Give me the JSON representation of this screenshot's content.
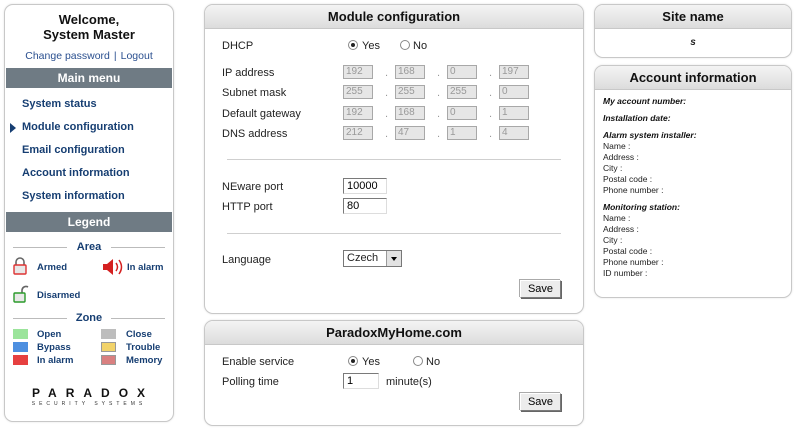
{
  "left": {
    "welcome_line1": "Welcome,",
    "welcome_line2": "System Master",
    "change_password": "Change password",
    "separator": "|",
    "logout": "Logout",
    "main_menu_title": "Main menu",
    "menu": [
      {
        "label": "System status",
        "active": false
      },
      {
        "label": "Module configuration",
        "active": true
      },
      {
        "label": "Email configuration",
        "active": false
      },
      {
        "label": "Account information",
        "active": false
      },
      {
        "label": "System information",
        "active": false
      }
    ],
    "legend_title": "Legend",
    "area_title": "Area",
    "area_items": {
      "armed": "Armed",
      "in_alarm": "In alarm",
      "disarmed": "Disarmed"
    },
    "zone_title": "Zone",
    "zone_items": [
      {
        "label": "Open",
        "color": "#9be49b"
      },
      {
        "label": "Close",
        "color": "#bdbdbd"
      },
      {
        "label": "Bypass",
        "color": "#4d8fe0"
      },
      {
        "label": "Trouble",
        "color": "#f2d36a"
      },
      {
        "label": "In alarm",
        "color": "#e64040"
      },
      {
        "label": "Memory",
        "color": "#d98080"
      }
    ],
    "logo_text": "PARADOX",
    "logo_sub": "SECURITY SYSTEMS"
  },
  "module": {
    "title": "Module configuration",
    "dhcp_label": "DHCP",
    "dhcp_yes": "Yes",
    "dhcp_no": "No",
    "dhcp_selected": "Yes",
    "ip_label": "IP address",
    "ip": [
      "192",
      "168",
      "0",
      "197"
    ],
    "mask_label": "Subnet mask",
    "mask": [
      "255",
      "255",
      "255",
      "0"
    ],
    "gw_label": "Default gateway",
    "gw": [
      "192",
      "168",
      "0",
      "1"
    ],
    "dns_label": "DNS address",
    "dns": [
      "212",
      "47",
      "1",
      "4"
    ],
    "dot": ".",
    "neware_label": "NEware port",
    "neware_port": "10000",
    "http_label": "HTTP port",
    "http_port": "80",
    "lang_label": "Language",
    "lang_value": "Czech",
    "save": "Save"
  },
  "pmh": {
    "title": "ParadoxMyHome.com",
    "enable_label": "Enable service",
    "yes": "Yes",
    "no": "No",
    "selected": "Yes",
    "poll_label": "Polling time",
    "poll_value": "1",
    "poll_unit": "minute(s)",
    "save": "Save"
  },
  "site": {
    "title": "Site name",
    "value": "s"
  },
  "account": {
    "title": "Account information",
    "account_number": "My account number:",
    "installation_date": "Installation date:",
    "installer_title": "Alarm system installer:",
    "installer_fields": [
      "Name :",
      "Address :",
      "City :",
      "Postal code :",
      "Phone number :"
    ],
    "monitoring_title": "Monitoring station:",
    "monitoring_fields": [
      "Name :",
      "Address :",
      "City :",
      "Postal code :",
      "Phone number :",
      "ID number :"
    ]
  }
}
